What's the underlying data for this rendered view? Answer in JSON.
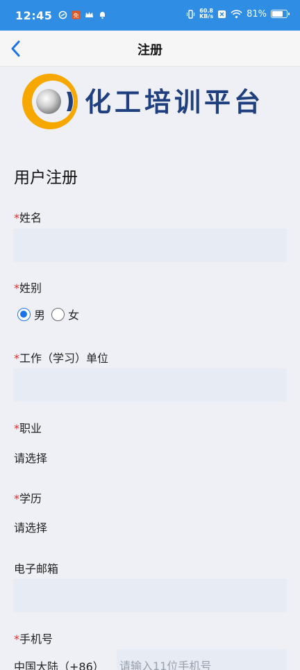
{
  "status_bar": {
    "time": "12:45",
    "net_speed_value": "60.8",
    "net_speed_unit": "KB/s",
    "battery_percent": "81%",
    "battery_level": 0.81
  },
  "nav": {
    "title": "注册"
  },
  "logo": {
    "text": "化工培训平台"
  },
  "form": {
    "title": "用户注册",
    "required_mark": "*",
    "name_label": "姓名",
    "gender_label": "姓别",
    "gender_options": [
      "男",
      "女"
    ],
    "gender_selected": "男",
    "work_unit_label": "工作（学习）单位",
    "occupation_label": "职业",
    "occupation_value": "请选择",
    "education_label": "学历",
    "education_value": "请选择",
    "email_label": "电子邮箱",
    "phone_label": "手机号",
    "phone_prefix": "中国大陆（+86）",
    "phone_placeholder": "请输入11位手机号"
  },
  "colors": {
    "status_bar": "#2f8de4",
    "accent": "#1a73e8",
    "required": "#e02a2a",
    "input_bg": "#e6ebf4",
    "logo_text": "#1f3f7f"
  }
}
